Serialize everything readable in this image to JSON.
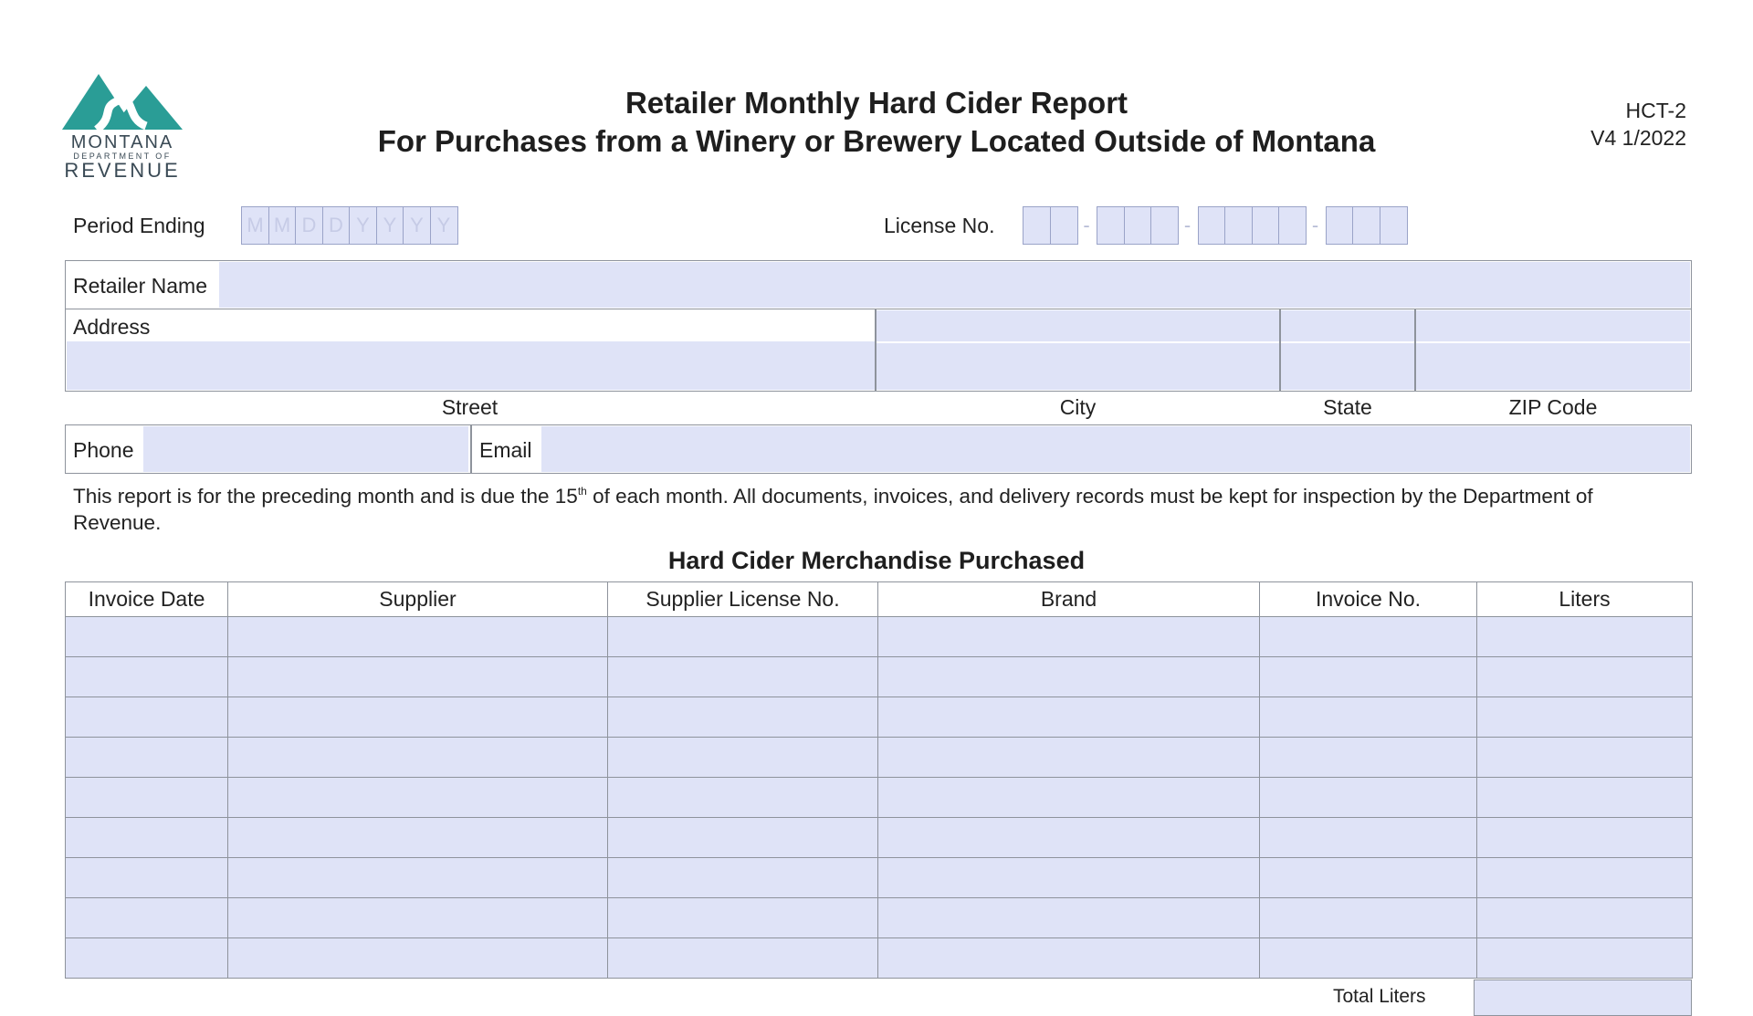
{
  "logo": {
    "line1": "MONTANA",
    "line2": "DEPARTMENT OF",
    "line3": "REVENUE",
    "color": "#2a9d96"
  },
  "header": {
    "title": "Retailer Monthly Hard Cider Report",
    "subtitle": "For Purchases from a Winery or Brewery Located Outside of Montana",
    "form_id": "HCT-2",
    "version": "V4 1/2022"
  },
  "period": {
    "label": "Period Ending",
    "placeholders": [
      "M",
      "M",
      "D",
      "D",
      "Y",
      "Y",
      "Y",
      "Y"
    ]
  },
  "license": {
    "label": "License No.",
    "groups": [
      2,
      3,
      4,
      3
    ],
    "separator": "-"
  },
  "retailer": {
    "name_label": "Retailer Name"
  },
  "address": {
    "label": "Address",
    "street_label": "Street",
    "city_label": "City",
    "state_label": "State",
    "zip_label": "ZIP Code"
  },
  "contact": {
    "phone_label": "Phone",
    "email_label": "Email"
  },
  "note": {
    "text_before": "This report is for the preceding month and is due the 15",
    "superscript": "th",
    "text_after": " of each month. All documents, invoices, and delivery records must be kept for inspection by the Department of Revenue."
  },
  "purchases": {
    "title": "Hard Cider Merchandise Purchased",
    "columns": [
      "Invoice Date",
      "Supplier",
      "Supplier License No.",
      "Brand",
      "Invoice No.",
      "Liters"
    ],
    "row_count": 9,
    "total_label": "Total Liters"
  },
  "colors": {
    "field_fill": "#dfe3f7",
    "border": "#8e939c",
    "box_border": "#9aa3c8"
  }
}
